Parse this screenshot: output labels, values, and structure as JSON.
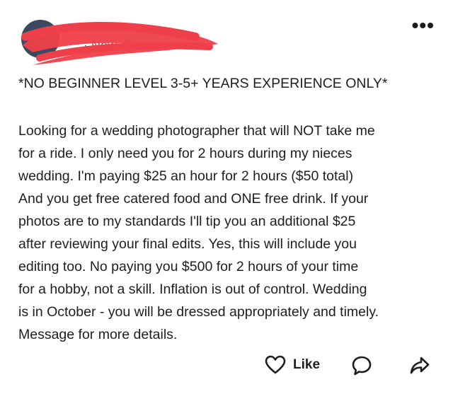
{
  "header": {
    "author_meta": "· Now",
    "more_label": "•••"
  },
  "post": {
    "headline": "*NO BEGINNER LEVEL 3-5+ YEARS EXPERIENCE ONLY*",
    "lines": [
      "Looking for a wedding photographer that will NOT take me",
      "for a ride. I only need you for 2 hours during my nieces",
      "wedding. I'm paying $25 an hour for 2 hours ($50 total)",
      "And you get free catered food and ONE free drink. If your",
      "photos are to my standards I'll tip you an additional $25",
      "after reviewing your final edits. Yes, this will include you",
      "editing too. No paying you $500 for 2 hours of your time",
      "for a hobby, not a skill. Inflation is out of control. Wedding",
      "is in October - you will be dressed appropriately and timely.",
      "Message for more details."
    ]
  },
  "actions": {
    "like_label": "Like"
  },
  "icons": {
    "globe": "globe-icon",
    "more": "more-options-icon",
    "like": "heart-icon",
    "comment": "comment-bubble-icon",
    "share": "share-arrow-icon"
  },
  "colors": {
    "text": "#1c1e21",
    "meta": "#65676b",
    "redaction": "#ef3f4a"
  }
}
